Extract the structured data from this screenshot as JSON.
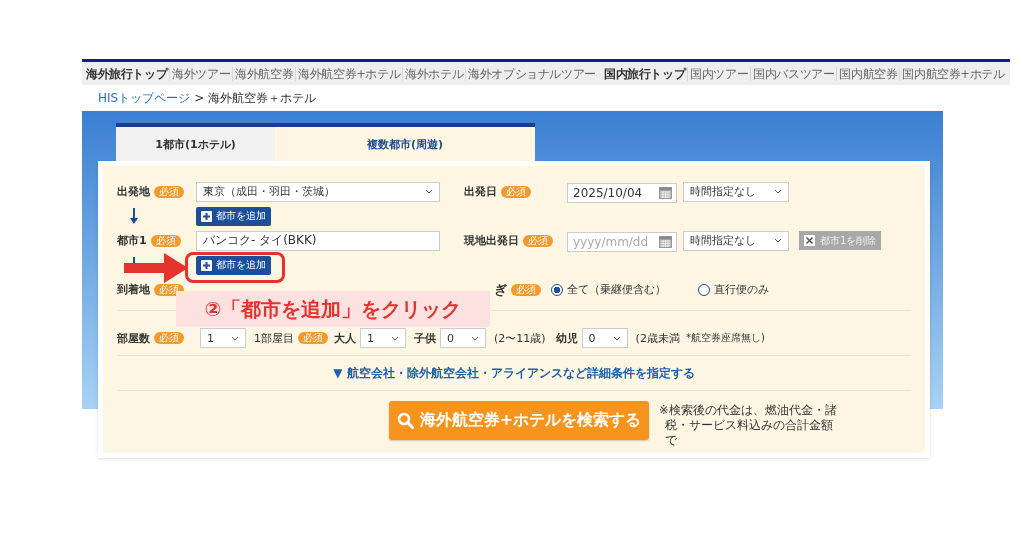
{
  "top_nav": [
    {
      "label": "海外旅行トップ",
      "kind": "section"
    },
    {
      "label": "海外ツアー",
      "kind": "link"
    },
    {
      "label": "海外航空券",
      "kind": "link"
    },
    {
      "label": "海外航空券+ホテル",
      "kind": "link"
    },
    {
      "label": "海外ホテル",
      "kind": "link"
    },
    {
      "label": "海外オプショナルツアー",
      "kind": "link"
    },
    {
      "label": "国内旅行トップ",
      "kind": "section"
    },
    {
      "label": "国内ツアー",
      "kind": "link"
    },
    {
      "label": "国内バスツアー",
      "kind": "link"
    },
    {
      "label": "国内航空券",
      "kind": "link"
    },
    {
      "label": "国内航空券+ホテル",
      "kind": "link"
    }
  ],
  "breadcrumb": {
    "link": "HISトップページ",
    "separator": ">",
    "current": "海外航空券＋ホテル"
  },
  "tabs": [
    {
      "label": "1都市(1ホテル)",
      "selected": false
    },
    {
      "label": "複数都市(周遊)",
      "selected": true
    }
  ],
  "form": {
    "departure": {
      "label": "出発地",
      "badge": "必須",
      "value": "東京（成田・羽田・茨城）"
    },
    "departure_date": {
      "label": "出発日",
      "badge": "必須",
      "value": "2025/10/04",
      "time": "時間指定なし"
    },
    "add_city_buttons": [
      "都市を追加",
      "都市を追加"
    ],
    "city_1": {
      "label": "都市1",
      "badge": "必須",
      "value": "バンコク- タイ(BKK)"
    },
    "local_departure_date": {
      "label": "現地出発日",
      "badge": "必須",
      "placeholder": "yyyy/mm/dd",
      "time": "時間指定なし"
    },
    "delete_city_button": {
      "label": "都市1を削除",
      "disabled": true
    },
    "arrival": {
      "label": "到着地",
      "badge": "必須"
    },
    "connection": {
      "label": "ぎ",
      "badge": "必須",
      "options": [
        {
          "label": "全て（乗継便含む）",
          "selected": true
        },
        {
          "label": "直行便のみ",
          "selected": false
        }
      ]
    },
    "rooms": {
      "label": "部屋数",
      "badge": "必須",
      "value": "1"
    },
    "room_1": {
      "label": "1部屋目",
      "badge": "必須"
    },
    "adults": {
      "label": "大人",
      "value": "1"
    },
    "children": {
      "label": "子供",
      "value": "0",
      "note": "(2〜11歳)"
    },
    "infants": {
      "label": "幼児",
      "value": "0",
      "note": "(2歳未満",
      "small_note": "*航空券座席無し)"
    },
    "details_link": "▼ 航空会社・除外航空会社・アライアンスなど詳細条件を指定する",
    "search_button": "海外航空券+ホテルを検索する",
    "footnote": "※検索後の代金は、燃油代金・諸税・サービス料込みの合計金額で"
  },
  "annotation": {
    "text": "②「都市を追加」をクリック"
  }
}
